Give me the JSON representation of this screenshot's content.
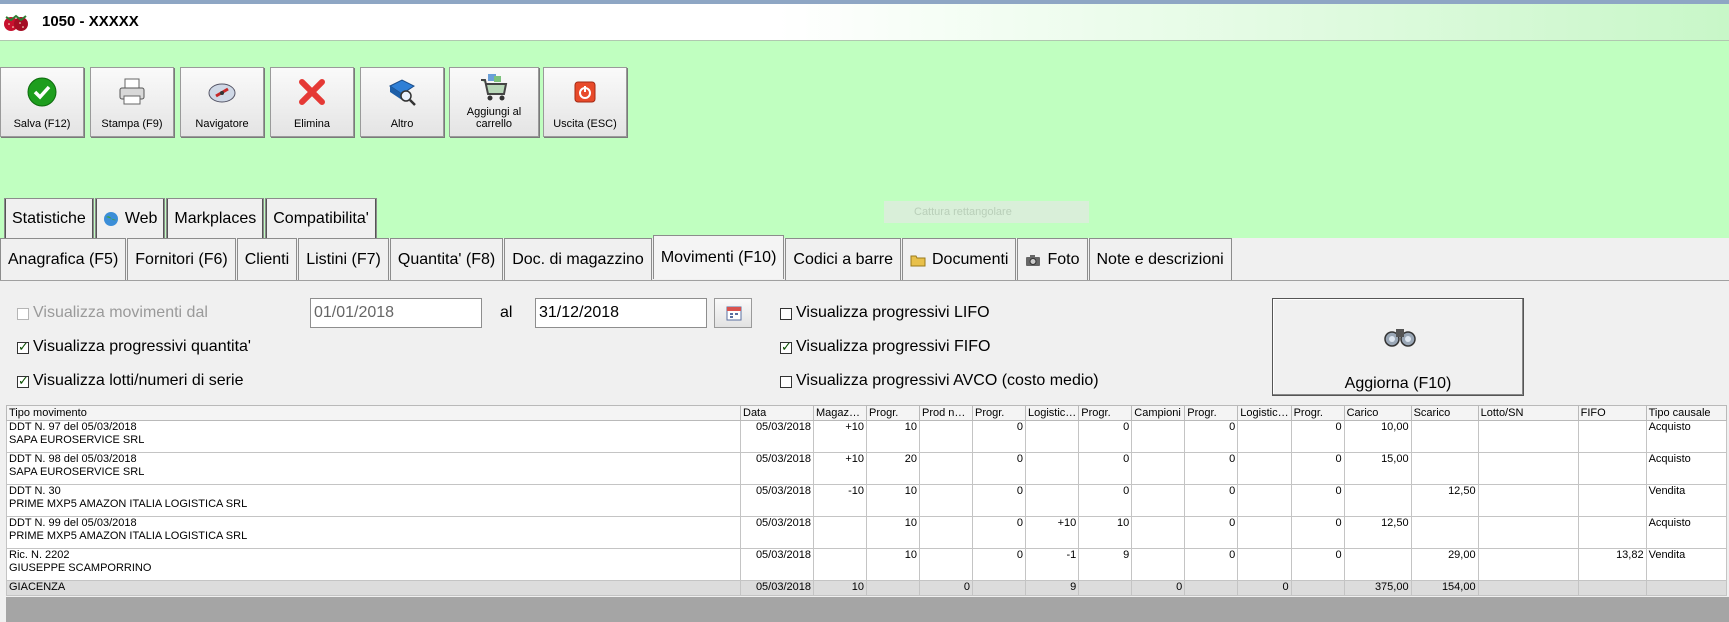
{
  "window": {
    "title": "1050 - XXXXX"
  },
  "toolbar": [
    {
      "label": "Salva (F12)",
      "icon": "check-icon"
    },
    {
      "label": "Stampa (F9)",
      "icon": "printer-icon"
    },
    {
      "label": "Navigatore",
      "icon": "compass-icon"
    },
    {
      "label": "Elimina",
      "icon": "delete-x-icon"
    },
    {
      "label": "Altro",
      "icon": "search-book-icon"
    },
    {
      "label": "Aggiungi al carrello",
      "icon": "cart-icon"
    },
    {
      "label": "Uscita (ESC)",
      "icon": "exit-icon"
    }
  ],
  "overlay": {
    "cattura": "Cattura rettangolare"
  },
  "tabs_row1": [
    "Statistiche",
    "Web",
    "Markplaces",
    "Compatibilita'"
  ],
  "tabs_row2": [
    "Anagrafica (F5)",
    "Fornitori (F6)",
    "Clienti",
    "Listini (F7)",
    "Quantita' (F8)",
    "Doc. di magazzino",
    "Movimenti (F10)",
    "Codici a barre",
    "Documenti",
    "Foto",
    "Note e descrizioni"
  ],
  "active_tab": "Movimenti (F10)",
  "filters": {
    "movimenti_dal": "Visualizza movimenti dal",
    "date_from": "01/01/2018",
    "al": "al",
    "date_to": "31/12/2018",
    "progressivi_quantita": "Visualizza progressivi quantita'",
    "lotti": "Visualizza lotti/numeri di serie",
    "lifo": "Visualizza progressivi LIFO",
    "fifo": "Visualizza progressivi FIFO",
    "avco": "Visualizza progressivi AVCO (costo medio)",
    "aggiorna": "Aggiorna (F10)"
  },
  "table": {
    "columns": [
      "Tipo movimento",
      "Data",
      "Magaz…",
      "Progr.",
      "Prod n…",
      "Progr.",
      "Logistic…",
      "Progr.",
      "Campioni",
      "Progr.",
      "Logistic…",
      "Progr.",
      "Carico",
      "Scarico",
      "Lotto/SN",
      "FIFO",
      "Tipo causale"
    ],
    "rows": [
      [
        "DDT N. 97 del 05/03/2018",
        "SAPA EUROSERVICE SRL",
        "05/03/2018",
        "+10",
        "10",
        "",
        "0",
        "",
        "0",
        "",
        "0",
        "",
        "0",
        "10,00",
        "",
        "",
        "",
        "Acquisto"
      ],
      [
        "DDT N. 98 del 05/03/2018",
        "SAPA EUROSERVICE SRL",
        "05/03/2018",
        "+10",
        "20",
        "",
        "0",
        "",
        "0",
        "",
        "0",
        "",
        "0",
        "15,00",
        "",
        "",
        "",
        "Acquisto"
      ],
      [
        "DDT N. 30",
        "PRIME MXP5 AMAZON ITALIA LOGISTICA SRL",
        "05/03/2018",
        "-10",
        "10",
        "",
        "0",
        "",
        "0",
        "",
        "0",
        "",
        "0",
        "",
        "12,50",
        "",
        "",
        "Vendita"
      ],
      [
        "DDT N. 99 del 05/03/2018",
        "PRIME MXP5 AMAZON ITALIA LOGISTICA SRL",
        "05/03/2018",
        "",
        "10",
        "",
        "0",
        "+10",
        "10",
        "",
        "0",
        "",
        "0",
        "12,50",
        "",
        "",
        "",
        "Acquisto"
      ],
      [
        "Ric. N. 2202",
        "GIUSEPPE SCAMPORRINO",
        "05/03/2018",
        "",
        "10",
        "",
        "0",
        "-1",
        "9",
        "",
        "0",
        "",
        "0",
        "",
        "29,00",
        "",
        "13,82",
        "Vendita"
      ]
    ],
    "total": [
      "GIACENZA",
      "05/03/2018",
      "10",
      "",
      "0",
      "",
      "9",
      "",
      "0",
      "",
      "0",
      "",
      "375,00",
      "154,00",
      "",
      "",
      ""
    ]
  }
}
